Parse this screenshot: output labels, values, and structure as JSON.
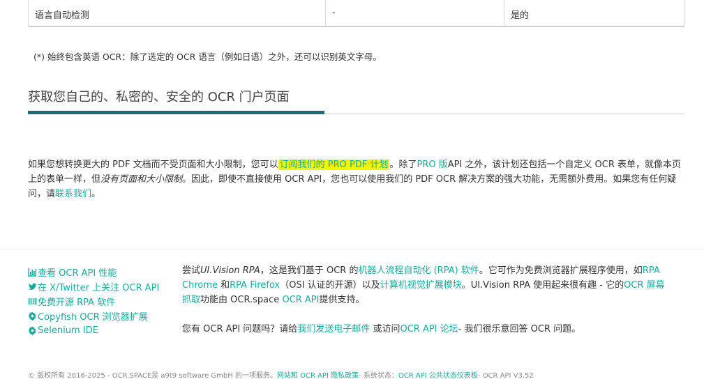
{
  "table": {
    "row": [
      "语言自动检测",
      "-",
      "是的"
    ]
  },
  "footnote": "(*) 始终包含英语 OCR：除了选定的 OCR 语言（例如日语）之外，还可以识别英文字母。",
  "section": {
    "title": "获取您自己的、私密的、安全的 OCR 门户页面"
  },
  "paragraph": {
    "p1": "如果您想转换更大的 PDF 文档而不受页面和大小限制，您可以",
    "link_subscribe": "订阅我们的 PRO PDF 计划",
    "p2": "。除了",
    "link_pro": "PRO 版",
    "p3": "API 之外，该计划还包括一个自定义 OCR 表单，就像本页上的表单一样，但",
    "em_text": "没有页面和大小限制",
    "p4": "。因此，即使不直接使用 OCR API，您也可以使用我们的 PDF OCR 解决方案的强大功能，无需额外费用。如果您有任何疑问，请",
    "link_contact": "联系我们",
    "p5": "。"
  },
  "footer_links": [
    {
      "label": "查看 OCR API 性能",
      "icon": "bar-chart-icon"
    },
    {
      "label": "在 X/Twitter 上关注 OCR API",
      "icon": "twitter-icon"
    },
    {
      "label": "免费开源 RPA 软件",
      "icon": "barcode-icon"
    },
    {
      "label": "Copyfish OCR 浏览器扩展",
      "icon": "gear-icon"
    },
    {
      "label": "Selenium IDE",
      "icon": "gear-icon"
    }
  ],
  "footer_text": {
    "t1": "尝试",
    "em_uivision": "UI.Vision RPA",
    "t2": "，这是我们基于 OCR 的",
    "link_rpa": "机器人流程自动化 (RPA) 软件",
    "t3": "。它可作为免费浏览器扩展程序使用，如",
    "link_chrome": "RPA Chrome",
    "t4": " 和",
    "link_firefox": "RPA Firefox",
    "t5": "（OSI 认证的开源）以及",
    "link_cv": "计算机视觉扩展模块",
    "t6": "。UI.Vision RPA 使用起来很有趣 - 它的",
    "link_scrape": "OCR 屏幕抓取",
    "t7": "功能由 OCR.space ",
    "link_api": "OCR API",
    "t8": "提供支持。",
    "q1": "您有 OCR API 问题吗？请给",
    "link_email": "我们发送电子邮件",
    "q2": " 或访问",
    "link_forum": "OCR API 论坛",
    "q3": "- 我们很乐意回答 OCR 问题。"
  },
  "copyright": {
    "c1": "© 版权所有 2016-2025 - OCR.SPACE是 a9t9 software GmbH 的一项服务。",
    "link_site": "网站和 OCR API 隐私政策",
    "c2": "- 系统状态：",
    "link_status": "OCR API 公共状态仪表板",
    "c3": "- OCR API V3.52"
  },
  "colors": {
    "link": "#1aaa9e",
    "accent_bar": "#1c6b78",
    "highlight": "#f4f400"
  }
}
